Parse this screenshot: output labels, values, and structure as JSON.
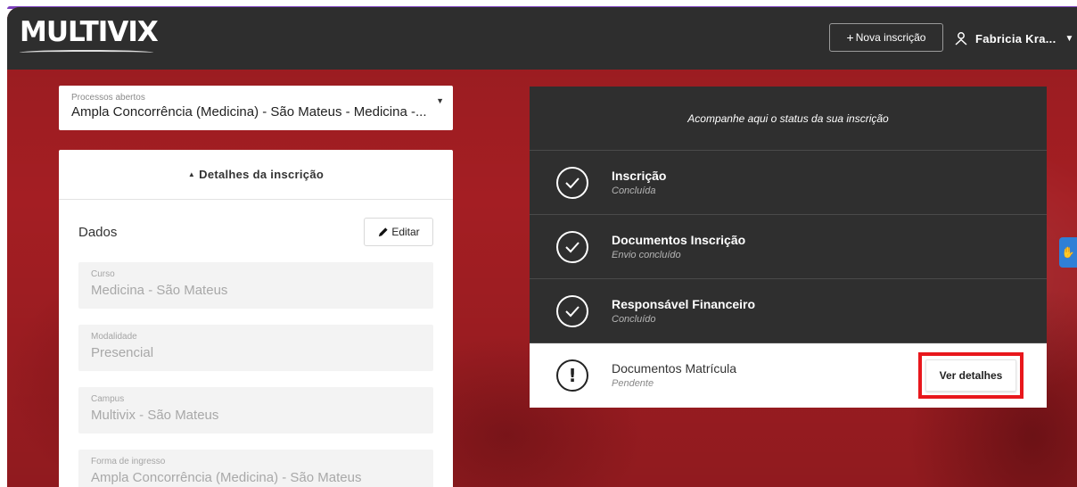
{
  "header": {
    "logo_text": "MULTIVIX",
    "nova_inscricao_label": "Nova inscrição",
    "user_name": "Fabricia Kra..."
  },
  "processos": {
    "label": "Processos abertos",
    "selected": "Ampla Concorrência (Medicina) - São Mateus - Medicina -..."
  },
  "details": {
    "toggle_label": "Detalhes da inscrição",
    "section_title": "Dados",
    "edit_label": "Editar",
    "fields": [
      {
        "label": "Curso",
        "value": "Medicina - São Mateus"
      },
      {
        "label": "Modalidade",
        "value": "Presencial"
      },
      {
        "label": "Campus",
        "value": "Multivix - São Mateus"
      },
      {
        "label": "Forma de ingresso",
        "value": "Ampla Concorrência (Medicina) - São Mateus"
      }
    ]
  },
  "status": {
    "heading": "Acompanhe aqui o status da sua inscrição",
    "steps": [
      {
        "title": "Inscrição",
        "status": "Concluída",
        "icon": "check-circle-icon"
      },
      {
        "title": "Documentos Inscrição",
        "status": "Envio concluído",
        "icon": "check-circle-icon"
      },
      {
        "title": "Responsável Financeiro",
        "status": "Concluído",
        "icon": "check-circle-icon"
      },
      {
        "title": "Documentos Matrícula",
        "status": "Pendente",
        "icon": "exclamation-circle-icon"
      }
    ],
    "action_label": "Ver detalhes"
  },
  "colors": {
    "background_red": "#a41e23",
    "header_dark": "#2e2e2e",
    "panel_dark": "#2f2f2f",
    "highlight_red": "#e8171c",
    "accent_purple": "#7b3fbd"
  }
}
